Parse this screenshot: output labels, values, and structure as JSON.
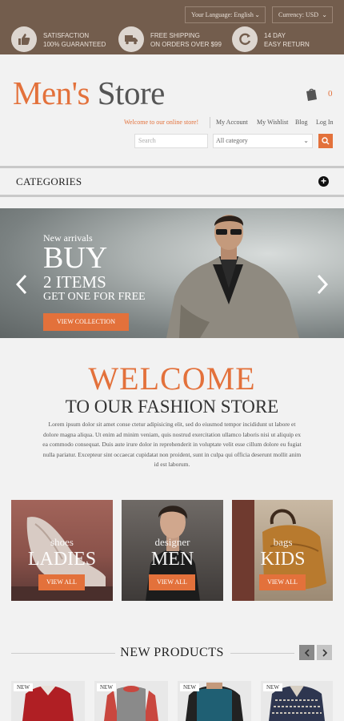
{
  "topbar": {
    "language": "Your Language: English",
    "currency": "Currency: USD",
    "promos": [
      {
        "icon": "thumbs-up-icon",
        "line1": "SATISFACTION",
        "line2": "100% GUARANTEED"
      },
      {
        "icon": "truck-icon",
        "line1": "FREE SHIPPING",
        "line2": "ON ORDERS OVER $99"
      },
      {
        "icon": "refresh-icon",
        "line1": "14 DAY",
        "line2": "EASY RETURN"
      }
    ]
  },
  "header": {
    "logo_part1": "Men's",
    "logo_part2": "Store",
    "cart_count": "0",
    "welcome": "Welcome to our online store!",
    "links": [
      "My Account",
      "My Wishlist",
      "Blog",
      "Log In"
    ],
    "search_placeholder": "Search",
    "category_select": "All category"
  },
  "categories_label": "CATEGORIES",
  "slider": {
    "small": "New arrivals",
    "big": "BUY",
    "mid": "2 ITEMS",
    "sub": "GET ONE FOR FREE",
    "button": "VIEW COLLECTION"
  },
  "welcome": {
    "title": "WELCOME",
    "subtitle": "TO OUR FASHION STORE",
    "text": "Lorem ipsum dolor sit amet conse ctetur adipisicing elit, sed do eiusmod tempor incididunt ut labore et dolore magna aliqua. Ut enim ad minim veniam, quis nostrud exercitation ullamco laboris nisi ut aliquip ex ea commodo consequat. Duis aute irure dolor in reprehenderit in voluptate velit esse cillum dolore eu fugiat nulla pariatur. Excepteur sint occaecat cupidatat non proident, sunt in culpa qui officia deserunt mollit anim id est laborum."
  },
  "tiles": [
    {
      "small": "shoes",
      "big": "LADIES",
      "button": "VIEW ALL"
    },
    {
      "small": "designer",
      "big": "MEN",
      "button": "VIEW ALL"
    },
    {
      "small": "bags",
      "big": "KIDS",
      "button": "VIEW ALL"
    }
  ],
  "new_products": {
    "title": "NEW PRODUCTS",
    "badge": "NEW"
  },
  "colors": {
    "accent": "#e3713b",
    "topbar": "#735d4d"
  }
}
